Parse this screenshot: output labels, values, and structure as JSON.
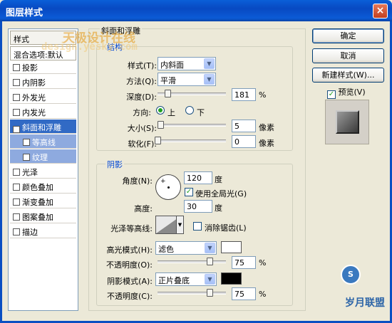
{
  "window": {
    "title": "图层样式",
    "close_label": "×"
  },
  "watermark": {
    "cn": "天极设计在线",
    "url": "design.yesky.com",
    "corner": "岁月联盟"
  },
  "style_list": {
    "header": "样式",
    "blend": "混合选项:默认",
    "items": [
      {
        "label": "投影",
        "checked": false
      },
      {
        "label": "内阴影",
        "checked": false
      },
      {
        "label": "外发光",
        "checked": false
      },
      {
        "label": "内发光",
        "checked": false
      },
      {
        "label": "斜面和浮雕",
        "checked": true,
        "selected": true
      },
      {
        "label": "等高线",
        "checked": false,
        "sub": true
      },
      {
        "label": "纹理",
        "checked": false,
        "sub": true
      },
      {
        "label": "光泽",
        "checked": false
      },
      {
        "label": "颜色叠加",
        "checked": false
      },
      {
        "label": "渐变叠加",
        "checked": false
      },
      {
        "label": "图案叠加",
        "checked": false
      },
      {
        "label": "描边",
        "checked": false
      }
    ]
  },
  "buttons": {
    "ok": "确定",
    "cancel": "取消",
    "new_style": "新建样式(W)...",
    "preview": "预览(V)"
  },
  "bevel": {
    "panel_title": "斜面和浮雕",
    "structure_title": "结构",
    "style_label": "样式(T):",
    "style_value": "内斜面",
    "technique_label": "方法(Q):",
    "technique_value": "平滑",
    "depth_label": "深度(D):",
    "depth_value": "181",
    "depth_unit": "%",
    "direction_label": "方向:",
    "dir_up": "上",
    "dir_down": "下",
    "size_label": "大小(S):",
    "size_value": "5",
    "size_unit": "像素",
    "soften_label": "软化(F):",
    "soften_value": "0",
    "soften_unit": "像素"
  },
  "shading": {
    "title": "阴影",
    "angle_label": "角度(N):",
    "angle_value": "120",
    "angle_unit": "度",
    "global_light": "使用全局光(G)",
    "altitude_label": "高度:",
    "altitude_value": "30",
    "altitude_unit": "度",
    "gloss_label": "光泽等高线:",
    "anti_alias": "消除锯齿(L)",
    "highlight_label": "高光模式(H):",
    "highlight_value": "滤色",
    "highlight_color": "#ffffff",
    "h_opacity_label": "不透明度(O):",
    "h_opacity_value": "75",
    "h_opacity_unit": "%",
    "shadow_label": "阴影模式(A):",
    "shadow_value": "正片叠底",
    "shadow_color": "#000000",
    "s_opacity_label": "不透明度(C):",
    "s_opacity_value": "75",
    "s_opacity_unit": "%"
  }
}
